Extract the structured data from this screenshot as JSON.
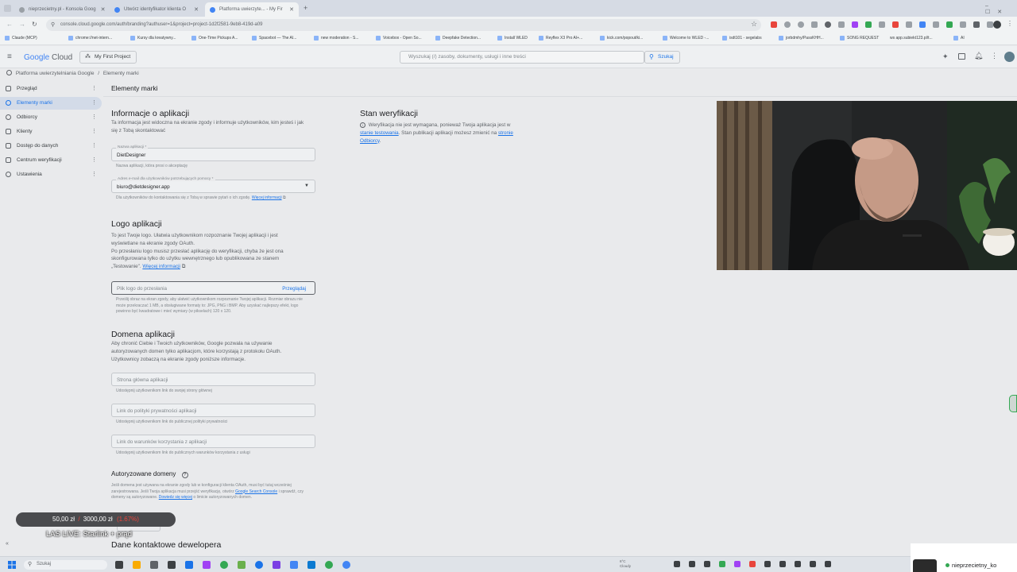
{
  "browser": {
    "tabs": [
      {
        "title": "nieprzecietny.pl - Konsola Goog"
      },
      {
        "title": "Utwórz identyfikator klienta O"
      },
      {
        "title": "Platforma uwierzyte... - My Fir"
      }
    ],
    "url": "console.cloud.google.com/auth/branding?authuser=1&project=project-1d2f2581-9eb8-419d-a09",
    "bookmarks": [
      "Claude (MCP)",
      "chrome://net-intern...",
      "Kursy dla kreatywny...",
      "One-Time Pickups A...",
      "Spacebot — The AI...",
      "new moderation - S...",
      "Voicebox - Open So...",
      "Deepfake Detection...",
      "Install WLED",
      "Reyflex X3 Pro AI+...",
      "kick.com/popout/ki...",
      "Welcome to WLED -...",
      "isdt101 - segelabs",
      "jorbdmhy/PassKHH...",
      "SONG REQUEST",
      "ws app.subiekt123.pl/t...",
      "AI"
    ]
  },
  "header": {
    "logo_word1": "Google",
    "logo_word2": "Cloud",
    "project": "My First Project",
    "search_placeholder": "Wyszukaj (/) zasoby, dokumenty, usługi i inne treści",
    "search_button": "Szukaj"
  },
  "breadcrumb": {
    "root": "Platforma uwierzytelniania Google",
    "sep": "/",
    "current": "Elementy marki"
  },
  "sidebar": {
    "items": [
      {
        "label": "Przegląd"
      },
      {
        "label": "Elementy marki"
      },
      {
        "label": "Odbiorcy"
      },
      {
        "label": "Klienty"
      },
      {
        "label": "Dostęp do danych"
      },
      {
        "label": "Centrum weryfikacji"
      },
      {
        "label": "Ustawienia"
      }
    ]
  },
  "main": {
    "page_title": "Elementy marki",
    "app_info": {
      "title": "Informacje o aplikacji",
      "desc": "Ta informacja jest widoczna na ekranie zgody i informuje użytkowników, kim jesteś i jak się z Tobą skontaktować",
      "name_label": "Nazwa aplikacji *",
      "name_value": "DietDesigner",
      "name_hint": "Nazwa aplikacji, która prosi o akceptację",
      "email_label": "Adres e-mail dla użytkowników potrzebujących pomocy *",
      "email_value": "biuro@dietdesigner.app",
      "email_hint": "Dla użytkowników do kontaktowania się z Tobą w sprawie pytań o ich zgodę.",
      "email_hint_link": "Więcej informacji"
    },
    "logo": {
      "title": "Logo aplikacji",
      "desc1": "To jest Twoje logo. Ułatwia użytkownikom rozpoznanie Twojej aplikacji i jest wyświetlane na ekranie zgody OAuth.",
      "desc2": "Po przesłaniu logo musisz przesłać aplikację do weryfikacji, chyba że jest ona skonfigurowana tylko do użytku wewnętrznego lub opublikowana ze stanem „Testowanie\".",
      "desc_link": "Więcej informacji",
      "file_placeholder": "Plik logo do przesłania",
      "browse": "Przeglądaj",
      "hint": "Prześlij obraz na ekran zgody, aby ułatwić użytkownikom rozpoznanie Twojej aplikacji. Rozmiar obrazu nie może przekraczać 1 MB, a obsługiwane formaty to: JPG, PNG i BMP. Aby uzyskać najlepszy efekt, logo powinno być kwadratowe i mieć wymiary (w pikselach) 120 x 120."
    },
    "domain": {
      "title": "Domena aplikacji",
      "desc": "Aby chronić Ciebie i Twoich użytkowników, Google pozwala na używanie autoryzowanych domen tylko aplikacjom, które korzystają z protokołu OAuth. Użytkownicy zobaczą na ekranie zgody poniższe informacje.",
      "home_placeholder": "Strona główna aplikacji",
      "home_hint": "Udostępnij użytkownikom link do swojej strony głównej",
      "privacy_placeholder": "Link do polityki prywatności aplikacji",
      "privacy_hint": "Udostępnij użytkownikom link do publicznej polityki prywatności",
      "terms_placeholder": "Link do warunków korzystania z aplikacji",
      "terms_hint": "Udostępnij użytkownikom link do publicznych warunków korzystania z usługi"
    },
    "authorized": {
      "title": "Autoryzowane domeny",
      "desc": "Jeśli domena jest używana na ekranie zgody lub w konfiguracji klienta OAuth, musi być tutaj wcześniej zarejestrowana. Jeśli Twoja aplikacja musi przejść weryfikację, otwórz",
      "link1": "Google Search Console",
      "desc2": "i sprawdź, czy domeny są autoryzowane.",
      "link2": "Dowiedz się więcej",
      "desc3": "o limicie autoryzowanych domen."
    },
    "developer": {
      "title": "Dane kontaktowe dewelopera"
    },
    "verification": {
      "title": "Stan weryfikacji",
      "text1": "Weryfikacja nie jest wymagana, ponieważ Twoja aplikacja jest w",
      "link1": "stanie testowania",
      "text2": ". Stan publikacji aplikacji możesz zmienić na",
      "link2": "stronie Odbiorcy",
      "text3": "."
    }
  },
  "overlay": {
    "donation_current": "50,00 zł",
    "donation_sep": "/",
    "donation_goal": "3000,00 zł",
    "donation_percent": "(1.67%)",
    "live": "LAS LIVE: Starlink + prąd",
    "streamer": "nieprzecietny_ko"
  },
  "taskbar": {
    "search": "Szukaj",
    "weather": "Cloudy",
    "temp": "6°C"
  },
  "colors": {
    "accent": "#1a73e8",
    "donation_percent": "#e8453c",
    "live_dot": "#34a853"
  }
}
